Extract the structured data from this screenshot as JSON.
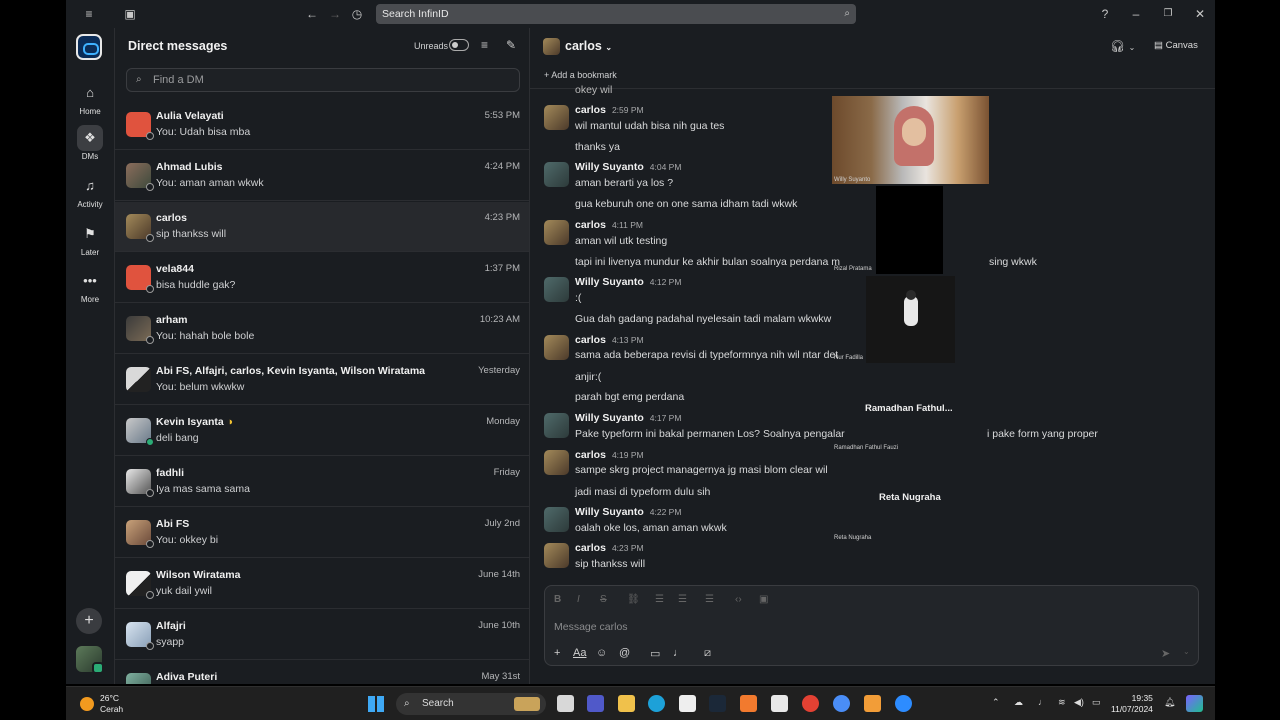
{
  "titlebar": {
    "search_placeholder": "Search InfinID"
  },
  "rail": {
    "items": [
      {
        "label": "Home",
        "icon": "home-icon"
      },
      {
        "label": "DMs",
        "icon": "dms-icon"
      },
      {
        "label": "Activity",
        "icon": "bell-icon"
      },
      {
        "label": "Later",
        "icon": "bookmark-icon"
      },
      {
        "label": "More",
        "icon": "more-icon"
      }
    ]
  },
  "dm_panel": {
    "title": "Direct messages",
    "unreads_label": "Unreads",
    "find_placeholder": "Find a DM",
    "items": [
      {
        "name": "Aulia Velayati",
        "preview": "You: Udah bisa mba",
        "time": "5:53 PM"
      },
      {
        "name": "Ahmad Lubis",
        "preview": "You: aman aman wkwk",
        "time": "4:24 PM"
      },
      {
        "name": "carlos",
        "preview": "sip thankss will",
        "time": "4:23 PM"
      },
      {
        "name": "vela844",
        "preview": "bisa huddle gak?",
        "time": "1:37 PM"
      },
      {
        "name": "arham",
        "preview": "You: hahah bole bole",
        "time": "10:23 AM"
      },
      {
        "name": "Abi FS, Alfajri, carlos, Kevin Isyanta, Wilson Wiratama",
        "preview": "You: belum wkwkw",
        "time": "Yesterday"
      },
      {
        "name": "Kevin Isyanta",
        "preview": "deli bang",
        "time": "Monday"
      },
      {
        "name": "fadhli",
        "preview": "Iya mas sama sama",
        "time": "Friday"
      },
      {
        "name": "Abi FS",
        "preview": "You: okkey bi",
        "time": "July 2nd"
      },
      {
        "name": "Wilson Wiratama",
        "preview": "yuk dail ywil",
        "time": "June 14th"
      },
      {
        "name": "Alfajri",
        "preview": "syapp",
        "time": "June 10th"
      },
      {
        "name": "Adiva Puteri",
        "preview": "",
        "time": "May 31st"
      }
    ]
  },
  "channel": {
    "title": "carlos",
    "bookmark_label": "Add a bookmark",
    "canvas_label": "Canvas",
    "composer_placeholder": "Message carlos",
    "top_cut_text": "okey wil",
    "messages": [
      {
        "author": "carlos",
        "time": "2:59 PM",
        "lines": [
          "wil mantul udah bisa nih gua tes",
          "thanks ya"
        ]
      },
      {
        "author": "Willy Suyanto",
        "time": "4:04 PM",
        "lines": [
          "aman berarti ya los ?",
          "gua keburuh one on one sama idham tadi wkwk"
        ]
      },
      {
        "author": "carlos",
        "time": "4:11 PM",
        "lines": [
          "aman wil utk testing",
          "tapi ini livenya mundur ke akhir bulan soalnya perdana m"
        ]
      },
      {
        "author": "Willy Suyanto",
        "time": "4:12 PM",
        "lines": [
          ":(",
          "Gua dah gadang padahal nyelesain tadi malam wkwkw"
        ]
      },
      {
        "author": "carlos",
        "time": "4:13 PM",
        "lines": [
          "sama ada beberapa revisi di typeformnya nih wil ntar det",
          "anjir:(",
          "parah bgt emg perdana"
        ]
      },
      {
        "author": "Willy Suyanto",
        "time": "4:17 PM",
        "lines": [
          "Pake typeform ini bakal permanen Los? Soalnya pengalar"
        ]
      },
      {
        "author": "carlos",
        "time": "4:19 PM",
        "lines": [
          "sampe skrg project managernya jg masi blom clear wil",
          "jadi masi di typeform dulu sih"
        ]
      },
      {
        "author": "Willy Suyanto",
        "time": "4:22 PM",
        "lines": [
          "oalah oke los, aman aman wkwk"
        ]
      },
      {
        "author": "carlos",
        "time": "4:23 PM",
        "lines": [
          "sip thankss will"
        ]
      }
    ],
    "overflow_fragments": {
      "a": "sing wkwk",
      "b": "i pake form yang proper"
    }
  },
  "video_call": {
    "tiles": [
      {
        "label": "Willy Suyanto",
        "name": ""
      },
      {
        "label": "Rizal Pratama",
        "name": ""
      },
      {
        "label": "Nur Fadilla",
        "name": ""
      },
      {
        "label": "Ramadhan Fathul Fauzi",
        "name": "Ramadhan  Fathul..."
      },
      {
        "label": "Reta Nugraha",
        "name": "Reta Nugraha"
      }
    ]
  },
  "taskbar": {
    "temp": "26°C",
    "weather": "Cerah",
    "search_label": "Search",
    "time": "19:35",
    "date": "11/07/2024"
  },
  "colors": {
    "bg": "#1a1d21",
    "accent_green": "#2bac76",
    "text": "#d1d2d3"
  }
}
